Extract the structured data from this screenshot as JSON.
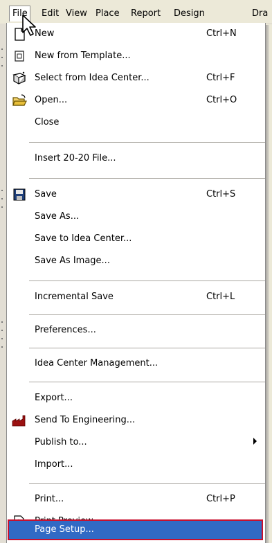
{
  "menubar": {
    "items": [
      {
        "label": "File"
      },
      {
        "label": "Edit"
      },
      {
        "label": "View"
      },
      {
        "label": "Place"
      },
      {
        "label": "Report"
      },
      {
        "label": "Design"
      },
      {
        "label": "Dra"
      }
    ]
  },
  "file_menu": {
    "items": [
      {
        "label": "New",
        "shortcut": "Ctrl+N",
        "icon": "new-document-icon"
      },
      {
        "label": "New from Template...",
        "icon": "template-icon"
      },
      {
        "label": "Select from Idea Center...",
        "shortcut": "Ctrl+F",
        "icon": "idea-center-icon"
      },
      {
        "label": "Open...",
        "shortcut": "Ctrl+O",
        "icon": "open-folder-icon"
      },
      {
        "label": "Close"
      },
      {
        "label": "Insert 20-20 File..."
      },
      {
        "label": "Save",
        "shortcut": "Ctrl+S",
        "icon": "save-disk-icon"
      },
      {
        "label": "Save As..."
      },
      {
        "label": "Save to Idea Center..."
      },
      {
        "label": "Save As Image..."
      },
      {
        "label": "Incremental Save",
        "shortcut": "Ctrl+L"
      },
      {
        "label": "Preferences..."
      },
      {
        "label": "Idea Center Management..."
      },
      {
        "label": "Export..."
      },
      {
        "label": "Send To Engineering...",
        "icon": "factory-icon"
      },
      {
        "label": "Publish to...",
        "submenu": true
      },
      {
        "label": "Import..."
      },
      {
        "label": "Print...",
        "shortcut": "Ctrl+P"
      },
      {
        "label": "Print Preview...",
        "icon": "print-preview-icon"
      },
      {
        "label": "Page Setup...",
        "highlighted": true
      }
    ]
  },
  "colors": {
    "highlight": "#316ac5",
    "highlight_border": "#c8102e",
    "menu_bg": "#ffffff",
    "chrome": "#ece9d8"
  }
}
